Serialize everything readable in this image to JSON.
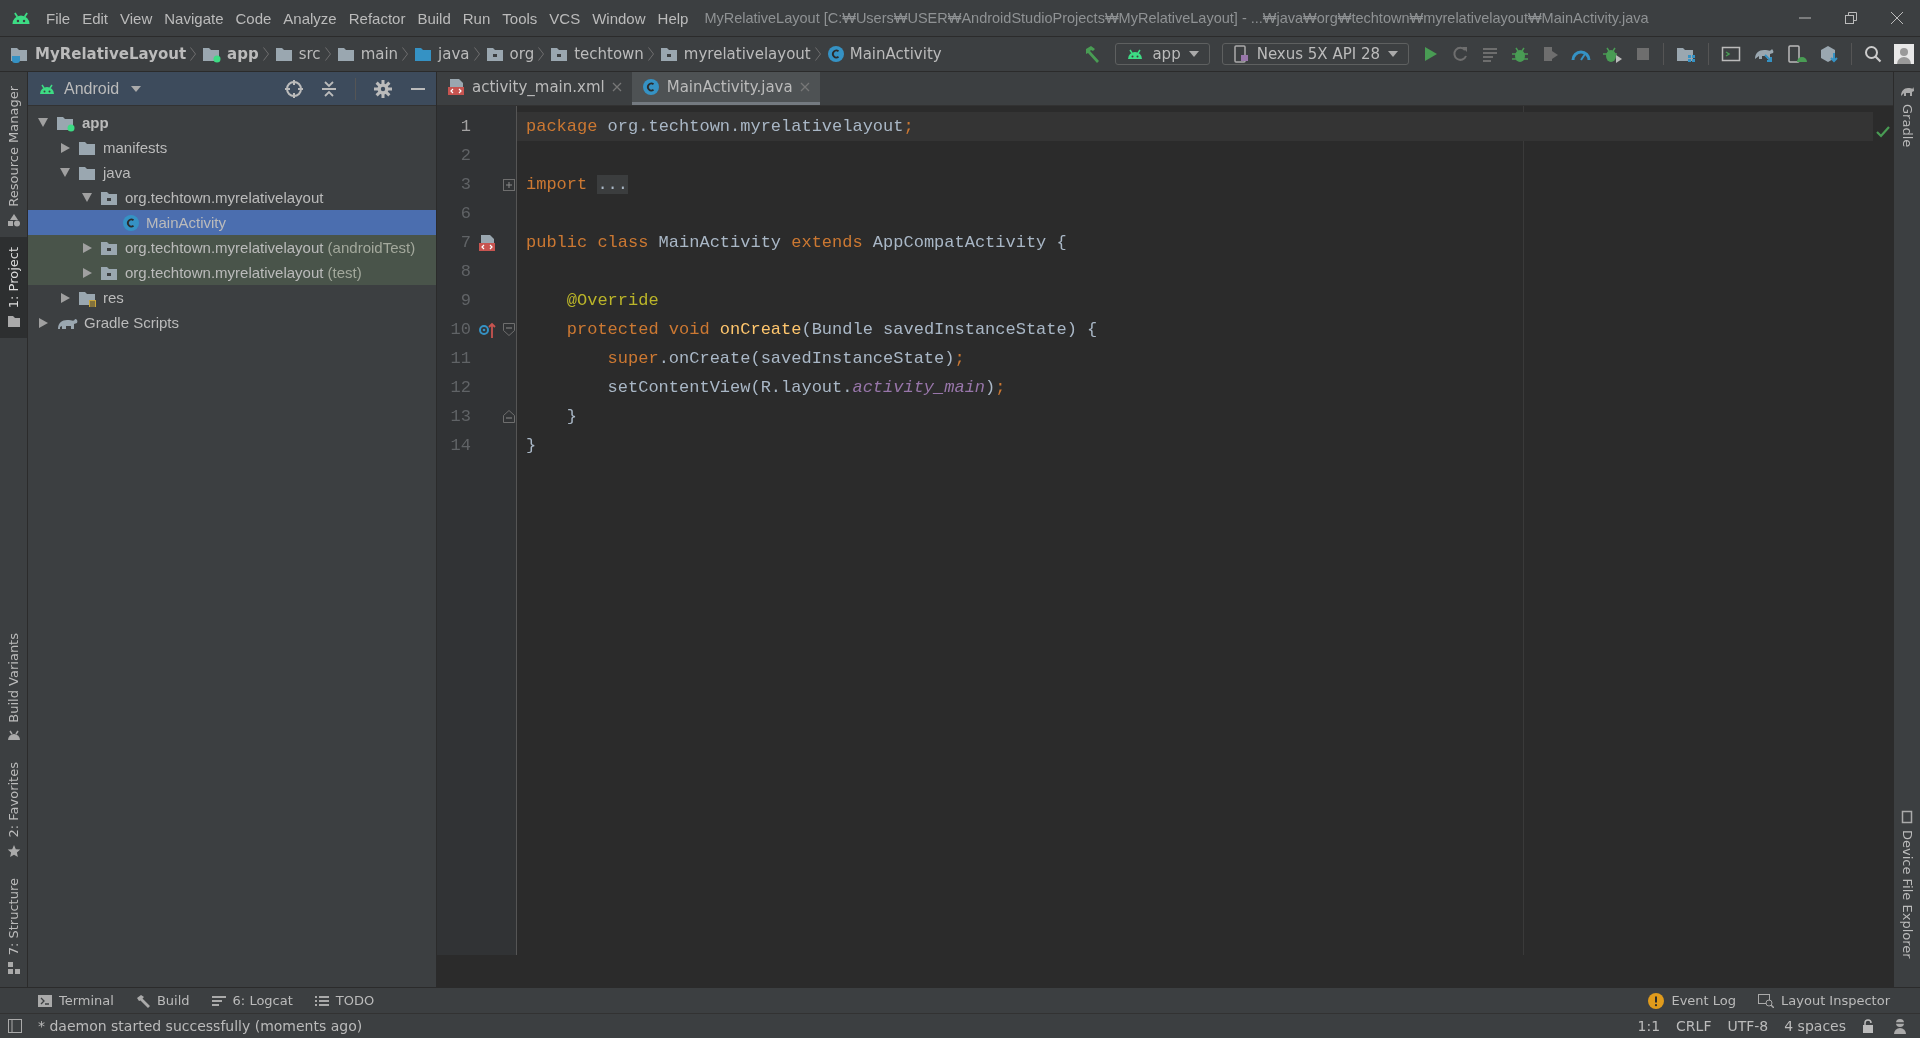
{
  "menu": {
    "items": [
      "File",
      "Edit",
      "View",
      "Navigate",
      "Code",
      "Analyze",
      "Refactor",
      "Build",
      "Run",
      "Tools",
      "VCS",
      "Window",
      "Help"
    ],
    "window_title": "MyRelativeLayout [C:₩Users₩USER₩AndroidStudioProjects₩MyRelativeLayout] - ...₩java₩org₩techtown₩myrelativelayout₩MainActivity.java"
  },
  "breadcrumbs": [
    {
      "label": "MyRelativeLayout",
      "kind": "project"
    },
    {
      "label": "app",
      "kind": "module"
    },
    {
      "label": "src",
      "kind": "folder"
    },
    {
      "label": "main",
      "kind": "folder"
    },
    {
      "label": "java",
      "kind": "source"
    },
    {
      "label": "org",
      "kind": "package"
    },
    {
      "label": "techtown",
      "kind": "package"
    },
    {
      "label": "myrelativelayout",
      "kind": "package"
    },
    {
      "label": "MainActivity",
      "kind": "class"
    }
  ],
  "toolbar": {
    "run_config": "app",
    "device": "Nexus 5X API 28"
  },
  "left_tools": [
    {
      "label": "Resource Manager",
      "selected": false,
      "kind": "resources"
    },
    {
      "label": "1: Project",
      "selected": true,
      "kind": "project"
    },
    {
      "label": "Build Variants",
      "selected": false,
      "kind": "variants"
    },
    {
      "label": "2: Favorites",
      "selected": false,
      "kind": "favorites"
    },
    {
      "label": "7: Structure",
      "selected": false,
      "kind": "structure"
    }
  ],
  "right_tools": [
    {
      "label": "Gradle",
      "kind": "gradle"
    },
    {
      "label": "Device File Explorer",
      "kind": "device"
    }
  ],
  "project_panel": {
    "view": "Android",
    "tree": [
      {
        "label": "app",
        "kind": "module",
        "expanded": true,
        "selected": false,
        "tinted": false,
        "children": [
          {
            "label": "manifests",
            "kind": "folder",
            "expanded": false,
            "selected": false,
            "tinted": false
          },
          {
            "label": "java",
            "kind": "folder",
            "expanded": true,
            "selected": false,
            "tinted": false,
            "children": [
              {
                "label": "org.techtown.myrelativelayout",
                "kind": "package",
                "expanded": true,
                "selected": false,
                "tinted": false,
                "children": [
                  {
                    "label": "MainActivity",
                    "kind": "class",
                    "selected": true,
                    "tinted": false
                  }
                ]
              },
              {
                "label": "org.techtown.myrelativelayout",
                "suffix": "(androidTest)",
                "kind": "package",
                "expanded": false,
                "selected": false,
                "tinted": true
              },
              {
                "label": "org.techtown.myrelativelayout",
                "suffix": "(test)",
                "kind": "package",
                "expanded": false,
                "selected": false,
                "tinted": true
              }
            ]
          },
          {
            "label": "res",
            "kind": "res",
            "expanded": false,
            "selected": false,
            "tinted": false
          }
        ]
      },
      {
        "label": "Gradle Scripts",
        "kind": "gradle",
        "expanded": false,
        "selected": false,
        "tinted": false
      }
    ]
  },
  "tabs": [
    {
      "label": "activity_main.xml",
      "kind": "xml",
      "selected": false
    },
    {
      "label": "MainActivity.java",
      "kind": "java",
      "selected": true
    }
  ],
  "code": [
    {
      "number": "1",
      "current": true,
      "tokens": [
        {
          "text": "package",
          "kind": "keyword"
        },
        {
          "text": " org.techtown.myrelativelayout",
          "kind": "plain"
        },
        {
          "text": ";",
          "kind": "keyword"
        }
      ]
    },
    {
      "number": "2",
      "current": false
    },
    {
      "number": "3",
      "current": false,
      "fold": {
        "kind": "expand"
      },
      "tokens": [
        {
          "text": "import ",
          "kind": "keyword"
        },
        {
          "text": "...",
          "kind": "folded"
        }
      ]
    },
    {
      "number": "6",
      "current": false
    },
    {
      "number": "7",
      "current": false,
      "gutter_icon": {
        "kind": "layout"
      },
      "tokens": [
        {
          "text": "public class",
          "kind": "keyword"
        },
        {
          "text": " MainActivity ",
          "kind": "plain"
        },
        {
          "text": "extends",
          "kind": "keyword"
        },
        {
          "text": " AppCompatActivity {",
          "kind": "plain"
        }
      ]
    },
    {
      "number": "8",
      "current": false
    },
    {
      "number": "9",
      "current": false,
      "tokens": [
        {
          "text": "    @Override",
          "kind": "annotation"
        }
      ]
    },
    {
      "number": "10",
      "current": false,
      "gutter_icon": {
        "kind": "override"
      },
      "fold": {
        "kind": "start"
      },
      "tokens": [
        {
          "text": "    protected void ",
          "kind": "keyword"
        },
        {
          "text": "onCreate",
          "kind": "method"
        },
        {
          "text": "(Bundle savedInstanceState) {",
          "kind": "plain"
        }
      ]
    },
    {
      "number": "11",
      "current": false,
      "tokens": [
        {
          "text": "        super",
          "kind": "keyword"
        },
        {
          "text": ".onCreate(savedInstanceState)",
          "kind": "plain"
        },
        {
          "text": ";",
          "kind": "keyword"
        }
      ]
    },
    {
      "number": "12",
      "current": false,
      "tokens": [
        {
          "text": "        setContentView(R.layout.",
          "kind": "plain"
        },
        {
          "text": "activity_main",
          "kind": "field"
        },
        {
          "text": ")",
          "kind": "plain"
        },
        {
          "text": ";",
          "kind": "keyword"
        }
      ]
    },
    {
      "number": "13",
      "current": false,
      "fold": {
        "kind": "end"
      },
      "tokens": [
        {
          "text": "    }",
          "kind": "plain"
        }
      ]
    },
    {
      "number": "14",
      "current": false,
      "tokens": [
        {
          "text": "}",
          "kind": "plain"
        }
      ]
    }
  ],
  "bottom_tools": [
    {
      "label": "Terminal",
      "kind": "terminal"
    },
    {
      "label": "Build",
      "kind": "build"
    },
    {
      "label": "6: Logcat",
      "kind": "logcat"
    },
    {
      "label": "TODO",
      "kind": "todo"
    }
  ],
  "bottom_tools_right": [
    {
      "label": "Event Log",
      "kind": "events"
    },
    {
      "label": "Layout Inspector",
      "kind": "inspector"
    }
  ],
  "status_bar": {
    "message": "* daemon started successfully (moments ago)",
    "items": [
      "1:1",
      "CRLF",
      "UTF-8",
      "4 spaces"
    ]
  }
}
